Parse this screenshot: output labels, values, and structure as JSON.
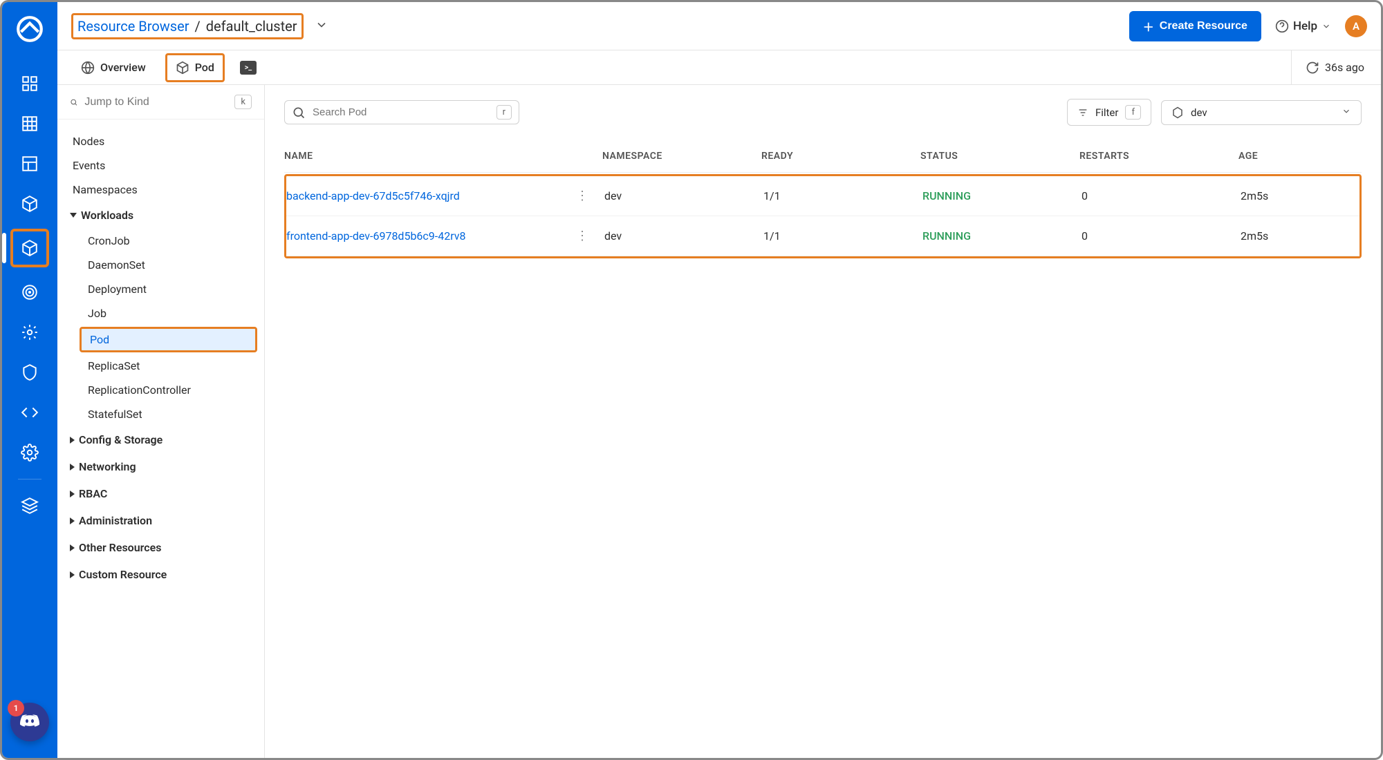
{
  "breadcrumb": {
    "root": "Resource Browser",
    "cluster": "default_cluster"
  },
  "actions": {
    "create": "Create Resource",
    "help": "Help"
  },
  "avatar": {
    "initial": "A"
  },
  "tabs": {
    "overview": "Overview",
    "pod": "Pod"
  },
  "refresh": {
    "label": "36s ago"
  },
  "sidebar": {
    "jump_placeholder": "Jump to Kind",
    "jump_key": "k",
    "nodes": "Nodes",
    "events": "Events",
    "namespaces": "Namespaces",
    "groups": {
      "workloads": "Workloads",
      "config_storage": "Config & Storage",
      "networking": "Networking",
      "rbac": "RBAC",
      "administration": "Administration",
      "other": "Other Resources",
      "custom": "Custom Resource"
    },
    "workloads": {
      "cronjob": "CronJob",
      "daemonset": "DaemonSet",
      "deployment": "Deployment",
      "job": "Job",
      "pod": "Pod",
      "replicaset": "ReplicaSet",
      "replicationcontroller": "ReplicationController",
      "statefulset": "StatefulSet"
    }
  },
  "toolbar": {
    "search_placeholder": "Search Pod",
    "search_key": "r",
    "filter": "Filter",
    "filter_key": "f",
    "namespace": "dev"
  },
  "table": {
    "headers": {
      "name": "NAME",
      "namespace": "NAMESPACE",
      "ready": "READY",
      "status": "STATUS",
      "restarts": "RESTARTS",
      "age": "AGE"
    },
    "rows": [
      {
        "name": "backend-app-dev-67d5c5f746-xqjrd",
        "namespace": "dev",
        "ready": "1/1",
        "status": "RUNNING",
        "restarts": "0",
        "age": "2m5s"
      },
      {
        "name": "frontend-app-dev-6978d5b6c9-42rv8",
        "namespace": "dev",
        "ready": "1/1",
        "status": "RUNNING",
        "restarts": "0",
        "age": "2m5s"
      }
    ]
  },
  "discord_notif": "1"
}
